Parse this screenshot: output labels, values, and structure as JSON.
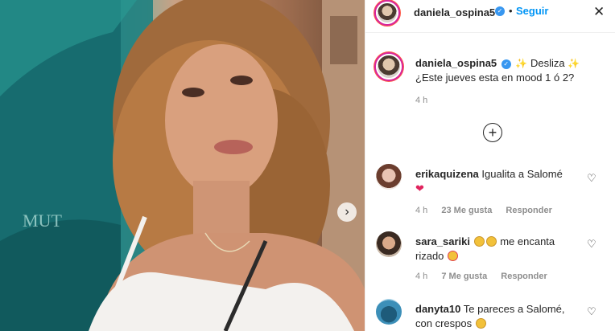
{
  "header": {
    "username": "daniela_ospina5",
    "separator": "•",
    "follow_label": "Seguir",
    "close_glyph": "✕"
  },
  "caption": {
    "username": "daniela_ospina5",
    "text_part1": "Desliza",
    "text_part2": "¿Este jueves esta en mood 1 ó 2?",
    "sparkle_glyph": "✨",
    "time": "4 h"
  },
  "load_more_glyph": "+",
  "comments": [
    {
      "username": "erikaquizena",
      "text": "Igualita a Salomé",
      "emoji": "❤",
      "time": "4 h",
      "likes": "23 Me gusta",
      "reply": "Responder"
    },
    {
      "username": "sara_sariki",
      "text_before": "",
      "text_after": "me encanta rizado",
      "time": "4 h",
      "likes": "7 Me gusta",
      "reply": "Responder"
    },
    {
      "username": "danyta10",
      "text": "Te pareces a Salomé, con crespos"
    }
  ],
  "icons": {
    "verified": "verified-badge-icon",
    "close": "close-icon",
    "heart": "heart-icon",
    "carousel_next": "chevron-right-icon",
    "load_more": "plus-circle-icon"
  },
  "colors": {
    "follow_blue": "#0095f6",
    "verified_blue": "#3897f0",
    "meta_gray": "#8e8e8e",
    "text_dark": "#262626"
  }
}
